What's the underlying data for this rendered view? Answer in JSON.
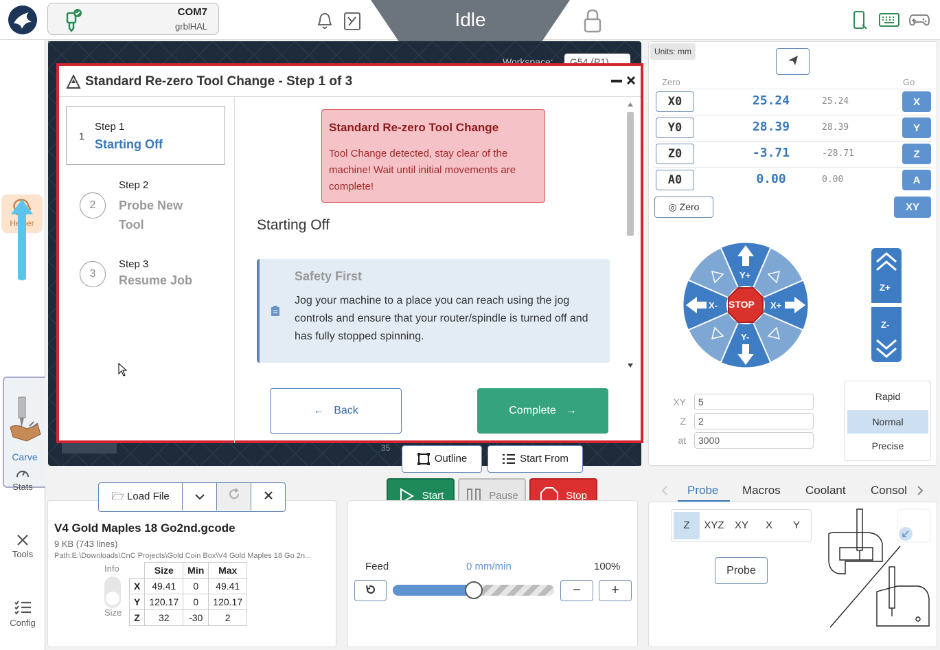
{
  "header": {
    "port": "COM7",
    "firmware": "grblHAL",
    "state": "Idle"
  },
  "nav": {
    "helper": "Helper",
    "carve": "Carve",
    "stats": "Stats",
    "tools": "Tools",
    "config": "Config"
  },
  "canvas": {
    "workspace_label": "Workspace:",
    "workspace_value": "G54 (P1)",
    "ruler_label": "35"
  },
  "modal": {
    "title": "Standard Re-zero Tool Change - Step 1 of 3",
    "steps": [
      {
        "num": "1",
        "step": "Step 1",
        "name": "Starting Off"
      },
      {
        "num": "2",
        "step": "Step 2",
        "name": "Probe New Tool"
      },
      {
        "num": "3",
        "step": "Step 3",
        "name": "Resume Job"
      }
    ],
    "alert_title": "Standard Re-zero Tool Change",
    "alert_body": "Tool Change detected, stay clear of the machine! Wait until initial movements are complete!",
    "section_title": "Starting Off",
    "safety_title": "Safety First",
    "safety_body": "Jog your machine to a place you can reach using the jog controls and ensure that your router/spindle is turned off and has fully stopped spinning.",
    "back_label": "Back",
    "complete_label": "Complete"
  },
  "dro": {
    "units": "Units: mm",
    "zero_header": "Zero",
    "go_header": "Go",
    "axes": [
      {
        "btn": "X0",
        "value": "25.24",
        "machine": "25.24",
        "go": "X"
      },
      {
        "btn": "Y0",
        "value": "28.39",
        "machine": "28.39",
        "go": "Y"
      },
      {
        "btn": "Z0",
        "value": "-3.71",
        "machine": "-28.71",
        "go": "Z"
      },
      {
        "btn": "A0",
        "value": "0.00",
        "machine": "0.00",
        "go": "A"
      }
    ],
    "zero_all": "Zero",
    "go_xy": "XY"
  },
  "jog": {
    "y_plus": "Y+",
    "y_minus": "Y-",
    "x_plus": "X+",
    "x_minus": "X-",
    "stop": "STOP",
    "z_plus": "Z+",
    "z_minus": "Z-",
    "xy_label": "XY",
    "xy_value": "5",
    "z_label": "Z",
    "z_value": "2",
    "at_label": "at",
    "at_value": "3000",
    "speeds": [
      "Rapid",
      "Normal",
      "Precise"
    ],
    "active_speed": "Normal"
  },
  "file": {
    "load_label": "Load File",
    "name": "V4 Gold Maples 18 Go2nd.gcode",
    "size": "9 KB (743 lines)",
    "path": "Path:E:\\Downloads\\CnC Projects\\Gold Coin Box\\V4 Gold Maples 18 Go 2n...",
    "info_label": "Info",
    "size_label": "Size",
    "headers": [
      "Size",
      "Min",
      "Max"
    ],
    "rows": [
      {
        "axis": "X",
        "size": "49.41",
        "min": "0",
        "max": "49.41"
      },
      {
        "axis": "Y",
        "size": "120.17",
        "min": "0",
        "max": "120.17"
      },
      {
        "axis": "Z",
        "size": "32",
        "min": "-30",
        "max": "2"
      }
    ]
  },
  "job": {
    "outline": "Outline",
    "start_from": "Start From",
    "start": "Start",
    "pause": "Pause",
    "stop": "Stop",
    "feed_label": "Feed",
    "feed_value": "0 mm/min",
    "feed_pct": "100%",
    "feed_fraction": 0.5
  },
  "probe": {
    "tabs": [
      "Probe",
      "Macros",
      "Coolant",
      "Consol"
    ],
    "active_tab": "Probe",
    "axes": [
      "Z",
      "XYZ",
      "XY",
      "X",
      "Y"
    ],
    "active_axis": "Z",
    "probe_btn": "Probe"
  }
}
